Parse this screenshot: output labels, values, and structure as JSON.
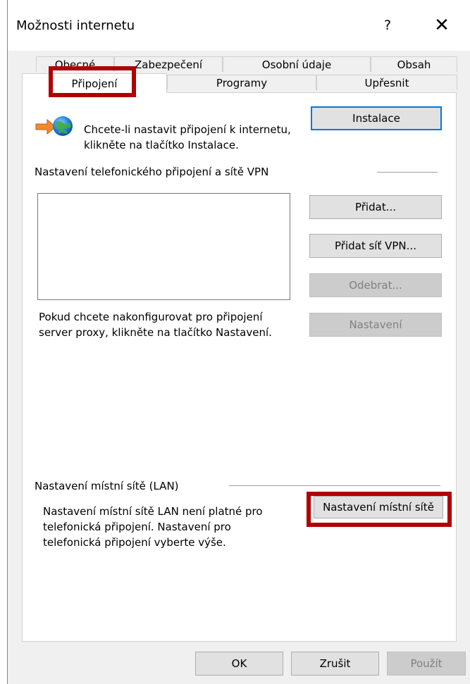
{
  "window": {
    "title": "Možnosti internetu",
    "help": "?",
    "close": "✕"
  },
  "tabs": {
    "row1": [
      "Obecné",
      "Zabezpečení",
      "Osobní údaje",
      "Obsah"
    ],
    "row2": [
      "Připojení",
      "Programy",
      "Upřesnit"
    ],
    "active": "Připojení"
  },
  "setup": {
    "text_line1": "Chcete-li nastavit připojení k internetu,",
    "text_line2": "klikněte na tlačítko Instalace.",
    "button": "Instalace",
    "icon": "globe-connection-icon"
  },
  "dialup": {
    "heading": "Nastavení telefonického připojení a sítě VPN",
    "add_button": "Přidat...",
    "add_vpn_button": "Přidat síť VPN...",
    "remove_button": "Odebrat...",
    "settings_button": "Nastavení",
    "proxy_line1": "Pokud chcete nakonfigurovat pro připojení",
    "proxy_line2": "server proxy, klikněte na tlačítko Nastavení."
  },
  "lan": {
    "heading": "Nastavení místní sítě (LAN)",
    "line1": "Nastavení místní sítě LAN není platné pro",
    "line2": "telefonická připojení. Nastavení pro",
    "line3": "telefonická připojení vyberte výše.",
    "button": "Nastavení místní sítě"
  },
  "footer": {
    "ok": "OK",
    "cancel": "Zrušit",
    "apply": "Použít"
  },
  "colors": {
    "highlight": "#b00000",
    "focus": "#0078d7"
  }
}
